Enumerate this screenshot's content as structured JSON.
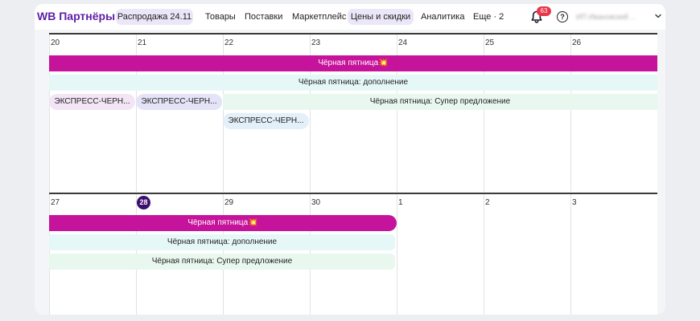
{
  "header": {
    "brand": "WB Партнёры",
    "nav": [
      "Распродажа 24.11",
      "Товары",
      "Поставки",
      "Маркетплейс",
      "Цены и скидки",
      "Аналитика",
      "Еще · 2"
    ],
    "notification_count": "63",
    "help_symbol": "?",
    "account_name": "ИП Ивановский ...",
    "accent_color": "#5b1fa6"
  },
  "calendar": {
    "week1": {
      "days": [
        "20",
        "21",
        "22",
        "23",
        "24",
        "25",
        "26"
      ],
      "events": {
        "black_friday": "Чёрная пятница💥",
        "addition": "Чёрная пятница: дополнение",
        "super_offer": "Чёрная пятница: Супер предложение",
        "express_1": "ЭКСПРЕСС-ЧЕРН...",
        "express_2": "ЭКСПРЕСС-ЧЕРН...",
        "express_3": "ЭКСПРЕСС-ЧЕРН..."
      }
    },
    "week2": {
      "days": [
        "27",
        "28",
        "29",
        "30",
        "1",
        "2",
        "3"
      ],
      "today_index": 1,
      "events": {
        "black_friday": "Чёрная пятница💥",
        "addition": "Чёрная пятница: дополнение",
        "super_offer": "Чёрная пятница: Супер предложение"
      }
    },
    "colors": {
      "main_event": "#c6139b",
      "today": "#3c0f6e"
    }
  }
}
